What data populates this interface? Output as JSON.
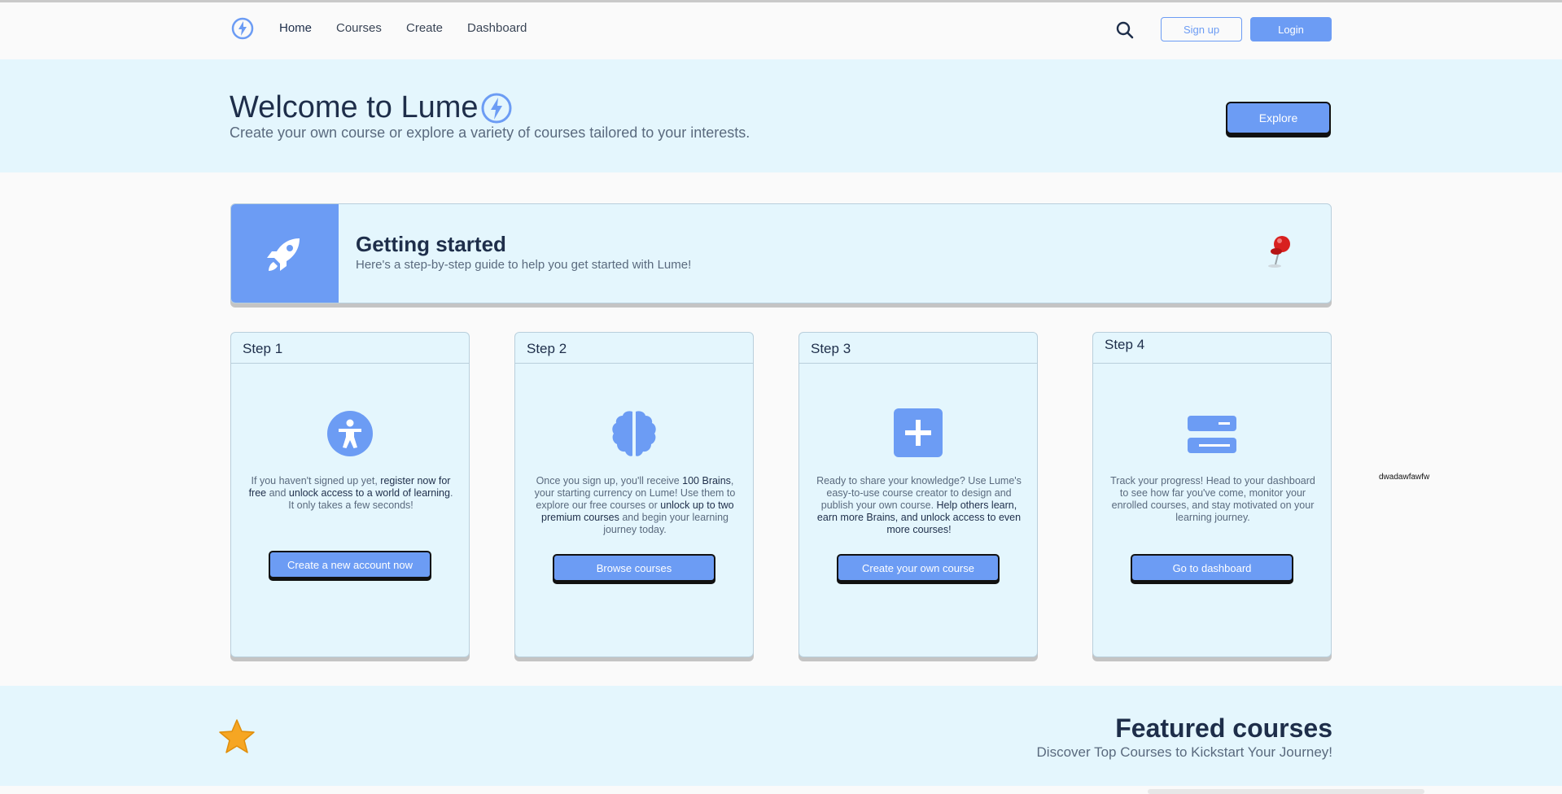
{
  "colors": {
    "accent": "#6c9cf4",
    "hero_bg": "#e4f6fd",
    "page_bg": "#fafafa",
    "text_dark": "#1e2e4a",
    "text_muted": "#5a6a7e"
  },
  "nav": {
    "logo_icon": "bolt-circle-icon",
    "links": [
      {
        "label": "Home",
        "active": true
      },
      {
        "label": "Courses",
        "active": false
      },
      {
        "label": "Create",
        "active": false
      },
      {
        "label": "Dashboard",
        "active": false
      }
    ],
    "search_icon": "search-icon",
    "signup_label": "Sign up",
    "login_label": "Login"
  },
  "hero": {
    "title": "Welcome to Lume",
    "title_icon": "bolt-circle-icon",
    "subtitle": "Create your own course or explore a variety of courses tailored to your interests.",
    "explore_label": "Explore"
  },
  "getting_started": {
    "icon": "rocket-icon",
    "title": "Getting started",
    "subtitle": "Here's a step-by-step guide to help you get started with Lume!",
    "pin_icon": "pushpin-icon"
  },
  "steps": [
    {
      "title": "Step 1",
      "icon": "accessibility-icon",
      "text_parts": [
        {
          "t": "If you haven't signed up yet, ",
          "bold": false
        },
        {
          "t": "register now for free",
          "bold": true
        },
        {
          "t": " and ",
          "bold": false
        },
        {
          "t": "unlock access to a world of learning",
          "bold": true
        },
        {
          "t": ". It only takes a few seconds!",
          "bold": false
        }
      ],
      "button": "Create a new account now"
    },
    {
      "title": "Step 2",
      "icon": "brain-icon",
      "text_parts": [
        {
          "t": "Once you sign up, you'll receive ",
          "bold": false
        },
        {
          "t": "100 Brains",
          "bold": true
        },
        {
          "t": ", your starting currency on Lume! Use them to explore our free courses or ",
          "bold": false
        },
        {
          "t": "unlock up to two premium courses",
          "bold": true
        },
        {
          "t": " and begin your learning journey today.",
          "bold": false
        }
      ],
      "button": "Browse courses"
    },
    {
      "title": "Step 3",
      "icon": "plus-square-icon",
      "text_parts": [
        {
          "t": "Ready to share your knowledge? Use Lume's easy-to-use course creator to design and publish your own course. ",
          "bold": false
        },
        {
          "t": "Help others learn, earn more Brains, and unlock access to even more courses!",
          "bold": true
        }
      ],
      "button": "Create your own course"
    },
    {
      "title": "Step 4",
      "icon": "progress-bars-icon",
      "text_parts": [
        {
          "t": "Track your progress! Head to your dashboard to see how far you've come, monitor your enrolled courses, and stay motivated on your learning journey.",
          "bold": false
        }
      ],
      "button": "Go to dashboard"
    }
  ],
  "stray_text": "dwadawfawfw",
  "featured": {
    "icon": "star-icon",
    "title": "Featured courses",
    "subtitle": "Discover Top Courses to Kickstart Your Journey!"
  }
}
